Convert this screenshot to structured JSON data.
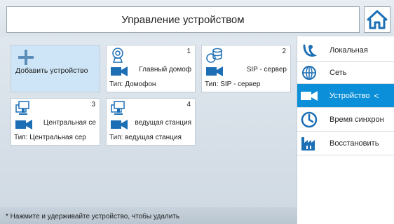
{
  "header": {
    "title": "Управление устройством"
  },
  "tiles": [
    {
      "add_label": "Добавить устройство"
    },
    {
      "number": "1",
      "name": "Главный домоф",
      "type": "Тип: Домофон"
    },
    {
      "number": "2",
      "name": "SIP - сервер",
      "type": "Тип: SIP - сервер"
    },
    {
      "number": "3",
      "name": "Центральная се",
      "type": "Тип: Центральная сер"
    },
    {
      "number": "4",
      "name": "ведущая станция",
      "type": "Тип: ведущая станция"
    }
  ],
  "footer": {
    "hint": "* Нажмите и удерживайте устройство, чтобы удалить"
  },
  "sidebar": {
    "items": [
      {
        "label": "Локальная",
        "icon": "local-icon"
      },
      {
        "label": "Сеть",
        "icon": "globe-icon"
      },
      {
        "label": "Устройство",
        "icon": "camera-icon",
        "active": true,
        "chevron": "<"
      },
      {
        "label": "Время синхрон",
        "icon": "clock-icon"
      },
      {
        "label": "Восстановить",
        "icon": "factory-icon"
      }
    ]
  },
  "colors": {
    "accent": "#0a8fd8",
    "icon_blue": "#1d6fb5",
    "add_tile": "#cde5f6"
  }
}
